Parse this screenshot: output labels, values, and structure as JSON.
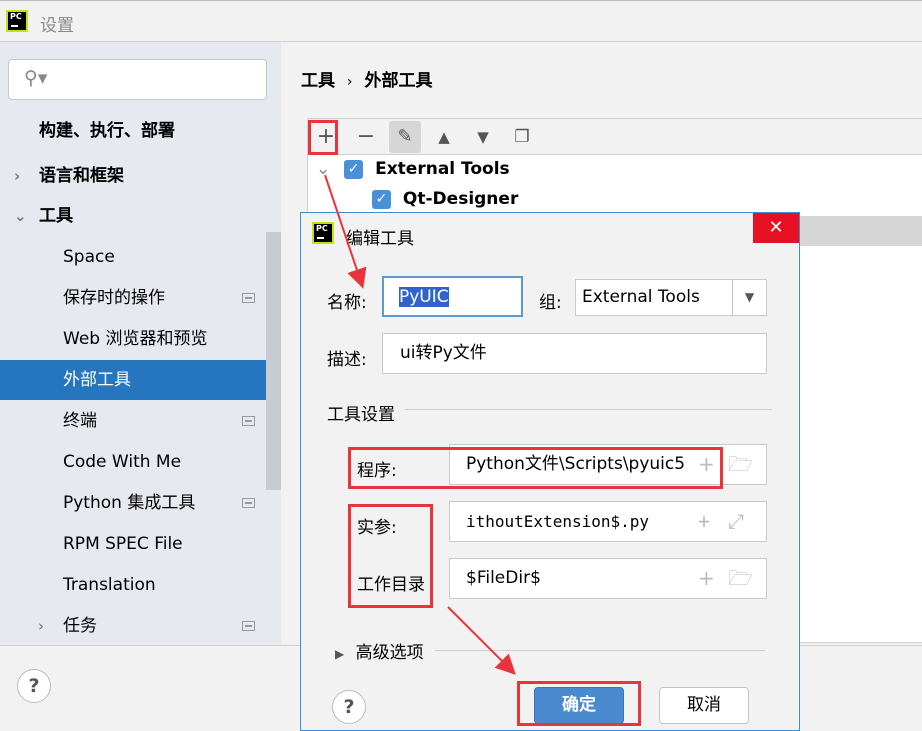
{
  "window": {
    "title": "设置",
    "logo_text": "PC"
  },
  "sidebar": {
    "search_placeholder": "",
    "items": [
      {
        "label": "构建、执行、部署"
      },
      {
        "label": "语言和框架"
      },
      {
        "label": "工具"
      },
      {
        "label": "Space"
      },
      {
        "label": "保存时的操作"
      },
      {
        "label": "Web 浏览器和预览"
      },
      {
        "label": "外部工具"
      },
      {
        "label": "终端"
      },
      {
        "label": "Code With Me"
      },
      {
        "label": "Python 集成工具"
      },
      {
        "label": "RPM SPEC File"
      },
      {
        "label": "Translation"
      },
      {
        "label": "任务"
      }
    ]
  },
  "breadcrumb": {
    "parent": "工具",
    "sep": "›",
    "current": "外部工具"
  },
  "tree": {
    "group": "External Tools",
    "item": "Qt-Designer"
  },
  "dialog": {
    "title": "编辑工具",
    "name_label": "名称:",
    "name_value": "PyUIC",
    "group_label": "组:",
    "group_value": "External Tools",
    "desc_label": "描述:",
    "desc_value": "ui转Py文件",
    "section": "工具设置",
    "program_label": "程序:",
    "program_value": "Python文件\\Scripts\\pyuic5",
    "args_label": "实参:",
    "args_value": "ithoutExtension$.py",
    "workdir_label": "工作目录",
    "workdir_value": "$FileDir$",
    "advanced": "高级选项",
    "ok": "确定",
    "cancel": "取消"
  },
  "colors": {
    "accent": "#2675bf",
    "annotation": "#e8343a",
    "ok_button": "#4a8bd0"
  }
}
